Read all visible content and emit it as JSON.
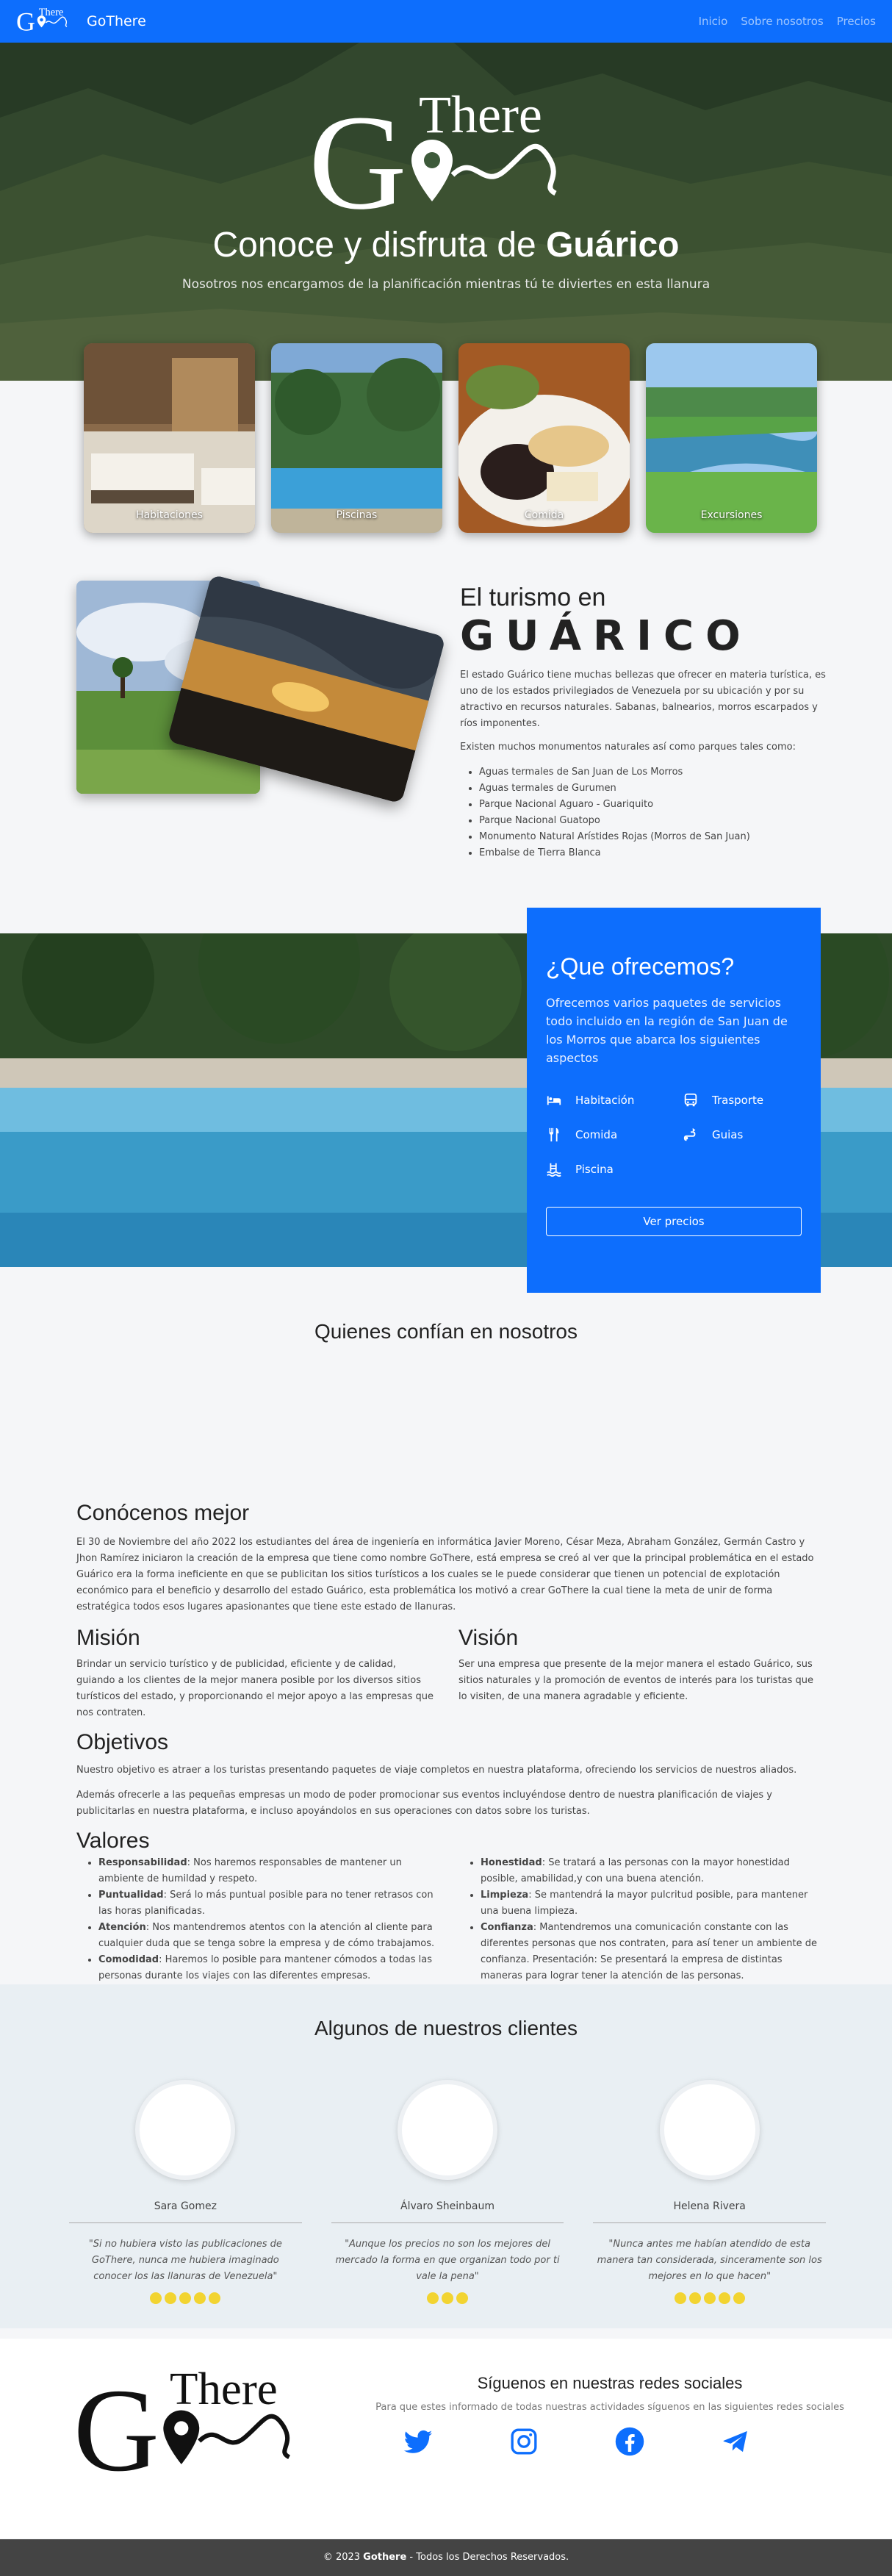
{
  "nav": {
    "brand": "GoThere",
    "links": [
      "Inicio",
      "Sobre nosotros",
      "Precios"
    ]
  },
  "logo_text": "GoThere",
  "hero": {
    "title_pre": "Conoce y disfruta de ",
    "title_bold": "Guárico",
    "subtitle": "Nosotros nos encargamos de la planificación mientras tú te diviertes en esta llanura"
  },
  "cards": [
    {
      "label": "Habitaciones"
    },
    {
      "label": "Piscinas"
    },
    {
      "label": "Comida"
    },
    {
      "label": "Excursiones"
    }
  ],
  "turismo": {
    "heading1": "El turismo en",
    "heading2": "GUÁRICO",
    "p1": "El estado Guárico tiene muchas bellezas que ofrecer en materia turística, es uno de los estados privilegiados de Venezuela por su ubicación y por su atractivo en recursos naturales. Sabanas, balnearios, morros escarpados y ríos imponentes.",
    "p2": "Existen muchos monumentos naturales así como parques tales como:",
    "list": [
      "Aguas termales de San Juan de Los Morros",
      "Aguas termales de Gurumen",
      "Parque Nacional Aguaro - Guariquito",
      "Parque Nacional Guatopo",
      "Monumento Natural Arístides Rojas (Morros de San Juan)",
      "Embalse de Tierra Blanca"
    ]
  },
  "offer": {
    "title": "¿Que ofrecemos?",
    "text": "Ofrecemos varios paquetes de servicios todo incluido en la región de San Juan de los Morros que abarca los siguientes aspectos",
    "items": [
      {
        "label": "Habitación",
        "icon": "bed-icon"
      },
      {
        "label": "Trasporte",
        "icon": "bus-icon"
      },
      {
        "label": "Comida",
        "icon": "utensils-icon"
      },
      {
        "label": "Guias",
        "icon": "guide-icon"
      },
      {
        "label": "Piscina",
        "icon": "pool-icon"
      }
    ],
    "button": "Ver precios"
  },
  "trust": {
    "title": "Quienes confían en nosotros"
  },
  "about": {
    "title": "Conócenos mejor",
    "text": "El 30 de Noviembre del año 2022 los estudiantes del área de ingeniería en informática Javier Moreno, César Meza, Abraham González, Germán Castro y Jhon Ramírez iniciaron la creación de la empresa que tiene como nombre GoThere, está empresa se creó al ver que la principal problemática en el estado Guárico era la forma ineficiente en que se publicitan los sitios turísticos a los cuales se le puede considerar que tienen un potencial de explotación económico para el beneficio y desarrollo del estado Guárico, esta problemática los motivó a crear GoThere la cual tiene la meta de unir de forma estratégica todos esos lugares apasionantes que tiene este estado de llanuras.",
    "mision_title": "Misión",
    "mision": "Brindar un servicio turístico y de publicidad, eficiente y de calidad, guiando a los clientes de la mejor manera posible por los diversos sitios turísticos del estado, y proporcionando el mejor apoyo a las empresas que nos contraten.",
    "vision_title": "Visión",
    "vision": "Ser una empresa que presente de la mejor manera el estado Guárico, sus sitios naturales y la promoción de eventos de interés para los turistas que lo visiten, de una manera agradable y eficiente.",
    "objetivos_title": "Objetivos",
    "objetivos_1": "Nuestro objetivo es atraer a los turistas presentando paquetes de viaje completos en nuestra plataforma, ofreciendo los servicios de nuestros aliados.",
    "objetivos_2": "Además ofrecerle a las pequeñas empresas un modo de poder promocionar sus eventos incluyéndose dentro de nuestra planificación de viajes y publicitarlas en nuestra plataforma, e incluso apoyándolos en sus operaciones con datos sobre los turistas.",
    "valores_title": "Valores",
    "valores_left": [
      {
        "name": "Responsabilidad",
        "text": ": Nos haremos responsables de mantener un ambiente de humildad y respeto."
      },
      {
        "name": "Puntualidad",
        "text": ": Será lo más puntual posible para no tener retrasos con las horas planificadas."
      },
      {
        "name": "Atención",
        "text": ": Nos mantendremos atentos con la atención al cliente para cualquier duda que se tenga sobre la empresa y de cómo trabajamos."
      },
      {
        "name": "Comodidad",
        "text": ": Haremos lo posible para mantener cómodos a todas las personas durante los viajes con las diferentes empresas."
      }
    ],
    "valores_right": [
      {
        "name": "Honestidad",
        "text": ": Se tratará a las personas con la mayor honestidad posible, amabilidad,y con una buena atención."
      },
      {
        "name": "Limpieza",
        "text": ": Se mantendrá la mayor pulcritud posible, para mantener una buena limpieza."
      },
      {
        "name": "Confianza",
        "text": ": Mantendremos una comunicación constante con las diferentes personas que nos contraten, para así tener un ambiente de confianza. Presentación: Se presentará la empresa de distintas maneras para lograr tener la atención de las personas."
      }
    ]
  },
  "clients": {
    "title": "Algunos de nuestros clientes",
    "list": [
      {
        "name": "Sara Gomez",
        "quote": "\"Si no hubiera visto las publicaciones de GoThere, nunca me hubiera imaginado conocer los las llanuras de Venezuela\"",
        "stars": 5
      },
      {
        "name": "Álvaro Sheinbaum",
        "quote": "\"Aunque los precios no son los mejores del mercado la forma en que organizan todo por ti vale la pena\"",
        "stars": 3
      },
      {
        "name": "Helena Rivera",
        "quote": "\"Nunca antes me habían atendido de esta manera tan considerada, sinceramente son los mejores en lo que hacen\"",
        "stars": 5
      }
    ]
  },
  "social": {
    "title": "Síguenos en nuestras redes sociales",
    "subtitle": "Para que estes informado de todas nuestras actividades síguenos en las siguientes redes sociales",
    "icons": [
      "twitter-icon",
      "instagram-icon",
      "facebook-icon",
      "telegram-icon"
    ]
  },
  "footer": {
    "pre": "© 2023 ",
    "brand": "Gothere",
    "post": " - Todos los Derechos Reservados."
  },
  "colors": {
    "primary": "#0d6efd",
    "footer": "#444444",
    "star": "#f2d431"
  }
}
